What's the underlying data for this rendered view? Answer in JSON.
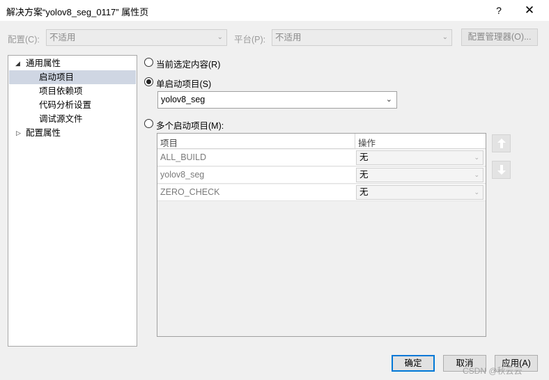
{
  "window": {
    "title": "解决方案“yolov8_seg_0117” 属性页",
    "help_label": "?",
    "close_label": "✕"
  },
  "config_bar": {
    "config_label": "配置(C):",
    "config_value": "不适用",
    "platform_label": "平台(P):",
    "platform_value": "不适用",
    "manager_label": "配置管理器(O)..."
  },
  "tree": {
    "common_props": "通用属性",
    "startup_project": "启动项目",
    "project_dependencies": "项目依赖项",
    "code_analysis": "代码分析设置",
    "debug_source_files": "调试源文件",
    "config_props": "配置属性"
  },
  "startup": {
    "current_selection_label": "当前选定内容(R)",
    "single_label": "单启动项目(S)",
    "single_value": "yolov8_seg",
    "multiple_label": "多个启动项目(M):",
    "selected_option": "single"
  },
  "grid": {
    "col_project": "项目",
    "col_action": "操作",
    "rows": [
      {
        "project": "ALL_BUILD",
        "action": "无"
      },
      {
        "project": "yolov8_seg",
        "action": "无"
      },
      {
        "project": "ZERO_CHECK",
        "action": "无"
      }
    ]
  },
  "buttons": {
    "ok": "确定",
    "cancel": "取消",
    "apply": "应用(A)"
  },
  "watermark": "CSDN @秋云云",
  "icons": {
    "move_up": "arrow-up-icon",
    "move_down": "arrow-down-icon"
  }
}
